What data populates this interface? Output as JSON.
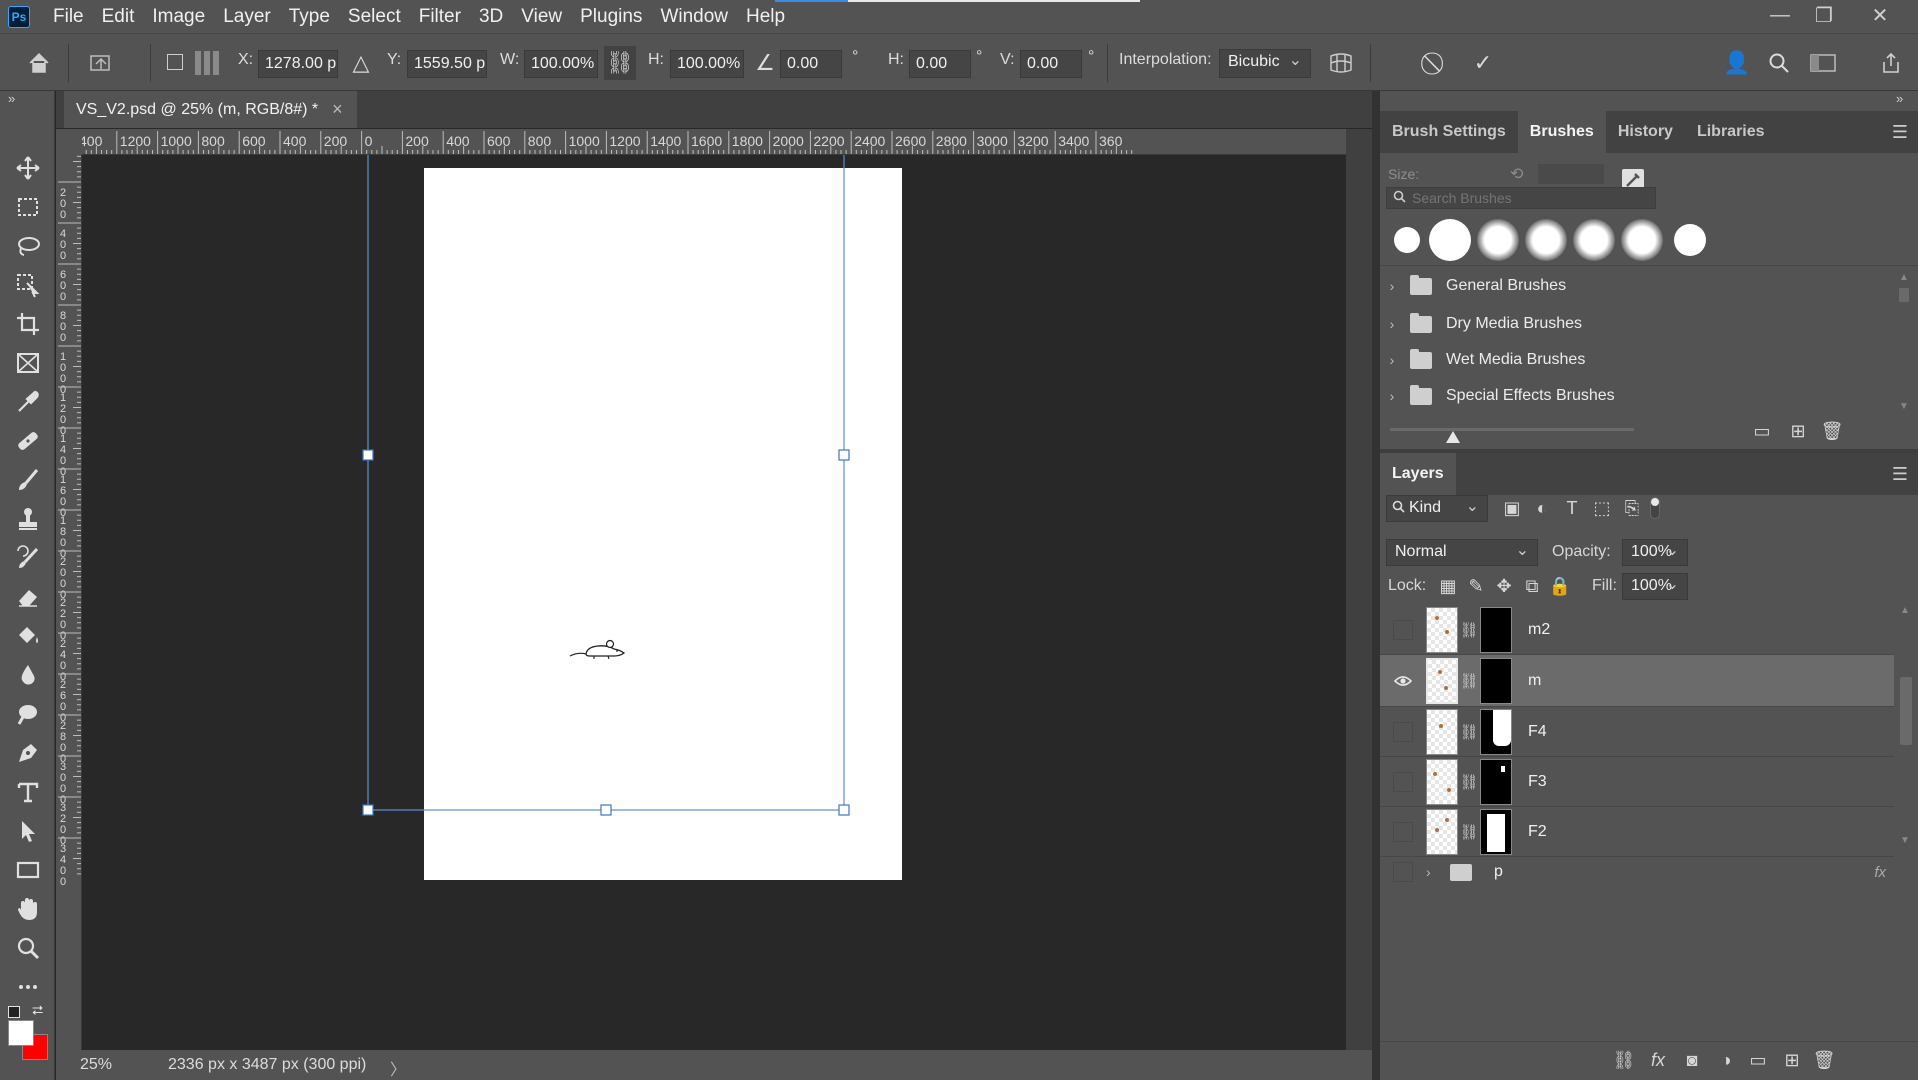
{
  "app": {
    "logo": "Ps"
  },
  "menu": [
    "File",
    "Edit",
    "Image",
    "Layer",
    "Type",
    "Select",
    "Filter",
    "3D",
    "View",
    "Plugins",
    "Window",
    "Help"
  ],
  "window_controls": {
    "minimize": "—",
    "restore": "❐",
    "close": "✕"
  },
  "options": {
    "x_label": "X:",
    "x_value": "1278.00 p",
    "y_label": "Y:",
    "y_value": "1559.50 p",
    "w_label": "W:",
    "w_value": "100.00%",
    "h_label": "H:",
    "h_value": "100.00%",
    "angle_value": "0.00",
    "deg": "°",
    "hskew_label": "H:",
    "hskew_value": "0.00",
    "vskew_label": "V:",
    "vskew_value": "0.00",
    "interp_label": "Interpolation:",
    "interp_value": "Bicubic"
  },
  "document": {
    "tab_title": "VS_V2.psd @ 25% (m, RGB/8#) *",
    "close": "×",
    "ruler_h_labels": [
      "400",
      "1200",
      "1000",
      "800",
      "600",
      "400",
      "200",
      "0",
      "200",
      "400",
      "600",
      "800",
      "1000",
      "1200",
      "1400",
      "1600",
      "1800",
      "2000",
      "2200",
      "2400",
      "2600",
      "2800",
      "3000",
      "3200",
      "3400",
      "360"
    ],
    "ruler_v_labels": [
      "0",
      "2 0 0",
      "4 0 0",
      "6 0 0",
      "8 0 0",
      "1 0 0 0",
      "1 2 0 0",
      "1 4 0 0",
      "1 6 0 0",
      "1 8 0 0",
      "2 0 0 0",
      "2 2 0 0",
      "2 4 0 0",
      "2 6 0 0",
      "2 8 0 0",
      "3 0 0 0",
      "3 2 0 0",
      "3 4 0 0"
    ]
  },
  "status": {
    "zoom": "25%",
    "doc_info": "2336 px x 3487 px (300 ppi)",
    "arrow": "〉"
  },
  "brush_panel": {
    "tabs": [
      "Brush Settings",
      "Brushes",
      "History",
      "Libraries"
    ],
    "active_tab": "Brushes",
    "size_label": "Size:",
    "search_placeholder": "Search Brushes",
    "folders": [
      "General Brushes",
      "Dry Media Brushes",
      "Wet Media Brushes",
      "Special Effects Brushes"
    ]
  },
  "layers_panel": {
    "title": "Layers",
    "kind_label": "Kind",
    "blend_mode": "Normal",
    "opacity_label": "Opacity:",
    "opacity_value": "100%",
    "lock_label": "Lock:",
    "fill_label": "Fill:",
    "fill_value": "100%",
    "layers": [
      {
        "name": "m2",
        "visible": false,
        "selected": false
      },
      {
        "name": "m",
        "visible": true,
        "selected": true
      },
      {
        "name": "F4",
        "visible": false,
        "selected": false
      },
      {
        "name": "F3",
        "visible": false,
        "selected": false
      },
      {
        "name": "F2",
        "visible": false,
        "selected": false
      },
      {
        "name": "p",
        "visible": false,
        "selected": false
      }
    ]
  },
  "colors": {
    "foreground": "#ffffff",
    "background": "#ff0000",
    "accent": "#3b8be0"
  }
}
